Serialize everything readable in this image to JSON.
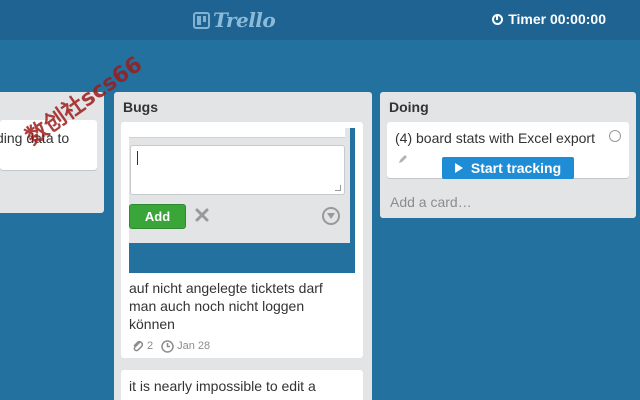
{
  "header": {
    "logo_text": "Trello",
    "timer_label": "Timer 00:00:00"
  },
  "lists": {
    "left": {
      "card_text": "ding data to"
    },
    "bugs": {
      "title": "Bugs",
      "add_button": "Add",
      "cards": [
        {
          "text": "auf nicht angelegte ticktets darf man auch noch nicht loggen können",
          "attachments": "2",
          "due": "Jan 28"
        },
        {
          "text": "it is nearly impossible to edit a"
        }
      ]
    },
    "doing": {
      "title": "Doing",
      "cards": [
        {
          "text": "(4) board stats with Excel export"
        }
      ],
      "start_tracking_label": "Start tracking",
      "add_card_placeholder": "Add a card…"
    }
  },
  "watermark": "数创社scs66",
  "colors": {
    "board_bg": "#23719f",
    "header_bg": "#1e6391",
    "list_bg": "#e2e4e6",
    "add_button": "#3aa63a",
    "start_tracking": "#1f8dd6"
  }
}
